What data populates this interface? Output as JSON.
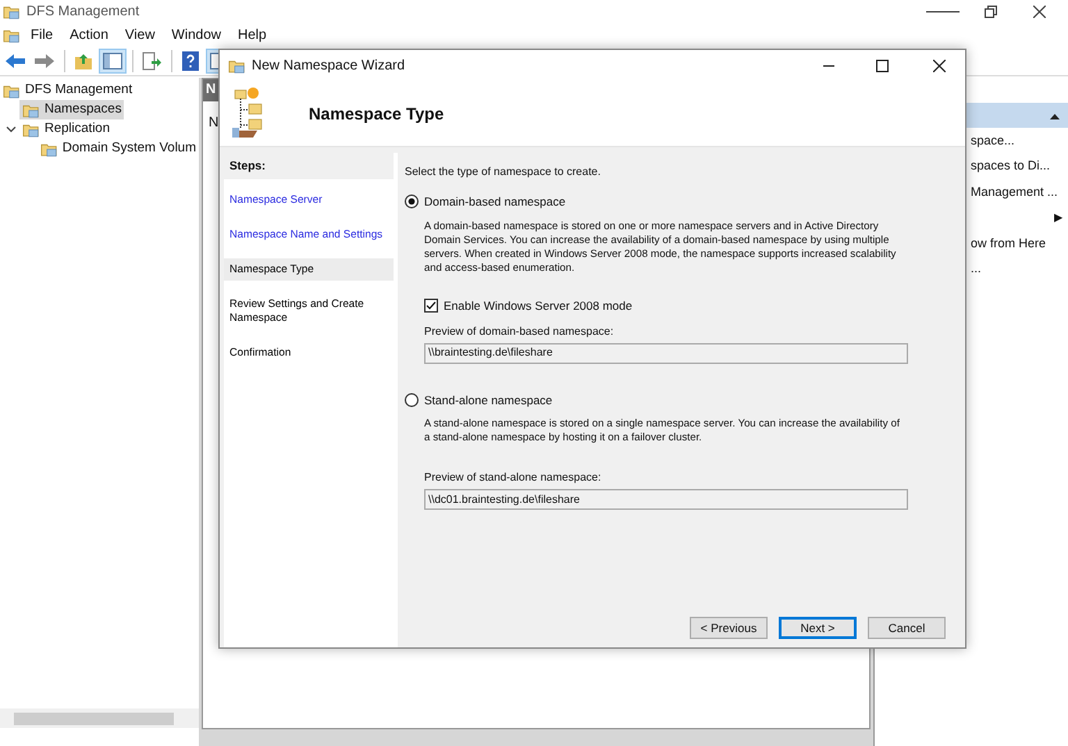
{
  "main_window": {
    "title": "DFS Management",
    "menu": [
      "File",
      "Action",
      "View",
      "Window",
      "Help"
    ],
    "toolbar": [
      {
        "kind": "back",
        "pressed": false
      },
      {
        "kind": "forward",
        "pressed": false
      },
      {
        "kind": "up",
        "pressed": false
      },
      {
        "kind": "tree",
        "pressed": true
      },
      {
        "kind": "export",
        "pressed": false
      },
      {
        "kind": "help",
        "pressed": false
      },
      {
        "kind": "pane",
        "pressed": true
      }
    ],
    "tree": [
      {
        "label": "DFS Management",
        "selected": false,
        "children": [
          {
            "label": "Namespaces",
            "selected": true
          },
          {
            "label": "Replication",
            "selected": false,
            "expanded": true,
            "children": [
              {
                "label": "Domain System Volum",
                "selected": false
              }
            ]
          }
        ]
      }
    ],
    "center_pane": {
      "header": "N",
      "text": "N"
    },
    "actions": [
      {
        "label": "space...",
        "kind": "item"
      },
      {
        "label": "spaces to Di...",
        "kind": "item"
      },
      {
        "label": "Management ...",
        "kind": "item"
      },
      {
        "label": "▶",
        "kind": "submenu"
      },
      {
        "label": "ow from Here",
        "kind": "item"
      },
      {
        "label": "...",
        "kind": "item"
      }
    ]
  },
  "dialog": {
    "title": "New Namespace Wizard",
    "header_title": "Namespace Type",
    "steps_heading": "Steps:",
    "steps": [
      {
        "label": "Namespace Server",
        "kind": "done"
      },
      {
        "label": "Namespace Name and Settings",
        "kind": "done"
      },
      {
        "label": "Namespace Type",
        "kind": "current"
      },
      {
        "label": "Review Settings and Create Namespace",
        "kind": "pending"
      },
      {
        "label": "Confirmation",
        "kind": "pending"
      }
    ],
    "instruction": "Select the type of namespace to create.",
    "options": [
      {
        "label": "Domain-based namespace",
        "selected": true,
        "description": "A domain-based namespace is stored on one or more namespace servers and in Active Directory Domain Services. You can increase the availability of a domain-based namespace by using multiple servers. When created in Windows Server 2008 mode, the namespace supports increased scalability and access-based enumeration.",
        "checkbox": {
          "label": "Enable Windows Server 2008 mode",
          "checked": true
        },
        "preview_label": "Preview of domain-based namespace:",
        "preview_value": "\\\\braintesting.de\\fileshare"
      },
      {
        "label": "Stand-alone namespace",
        "selected": false,
        "description": "A stand-alone namespace is stored on a single namespace server. You can increase the availability of a stand-alone namespace by hosting it on a failover cluster.",
        "preview_label": "Preview of stand-alone namespace:",
        "preview_value": "\\\\dc01.braintesting.de\\fileshare"
      }
    ],
    "buttons": [
      {
        "label": "< Previous",
        "default": false
      },
      {
        "label": "Next >",
        "default": true
      },
      {
        "label": "Cancel",
        "default": false
      }
    ]
  }
}
